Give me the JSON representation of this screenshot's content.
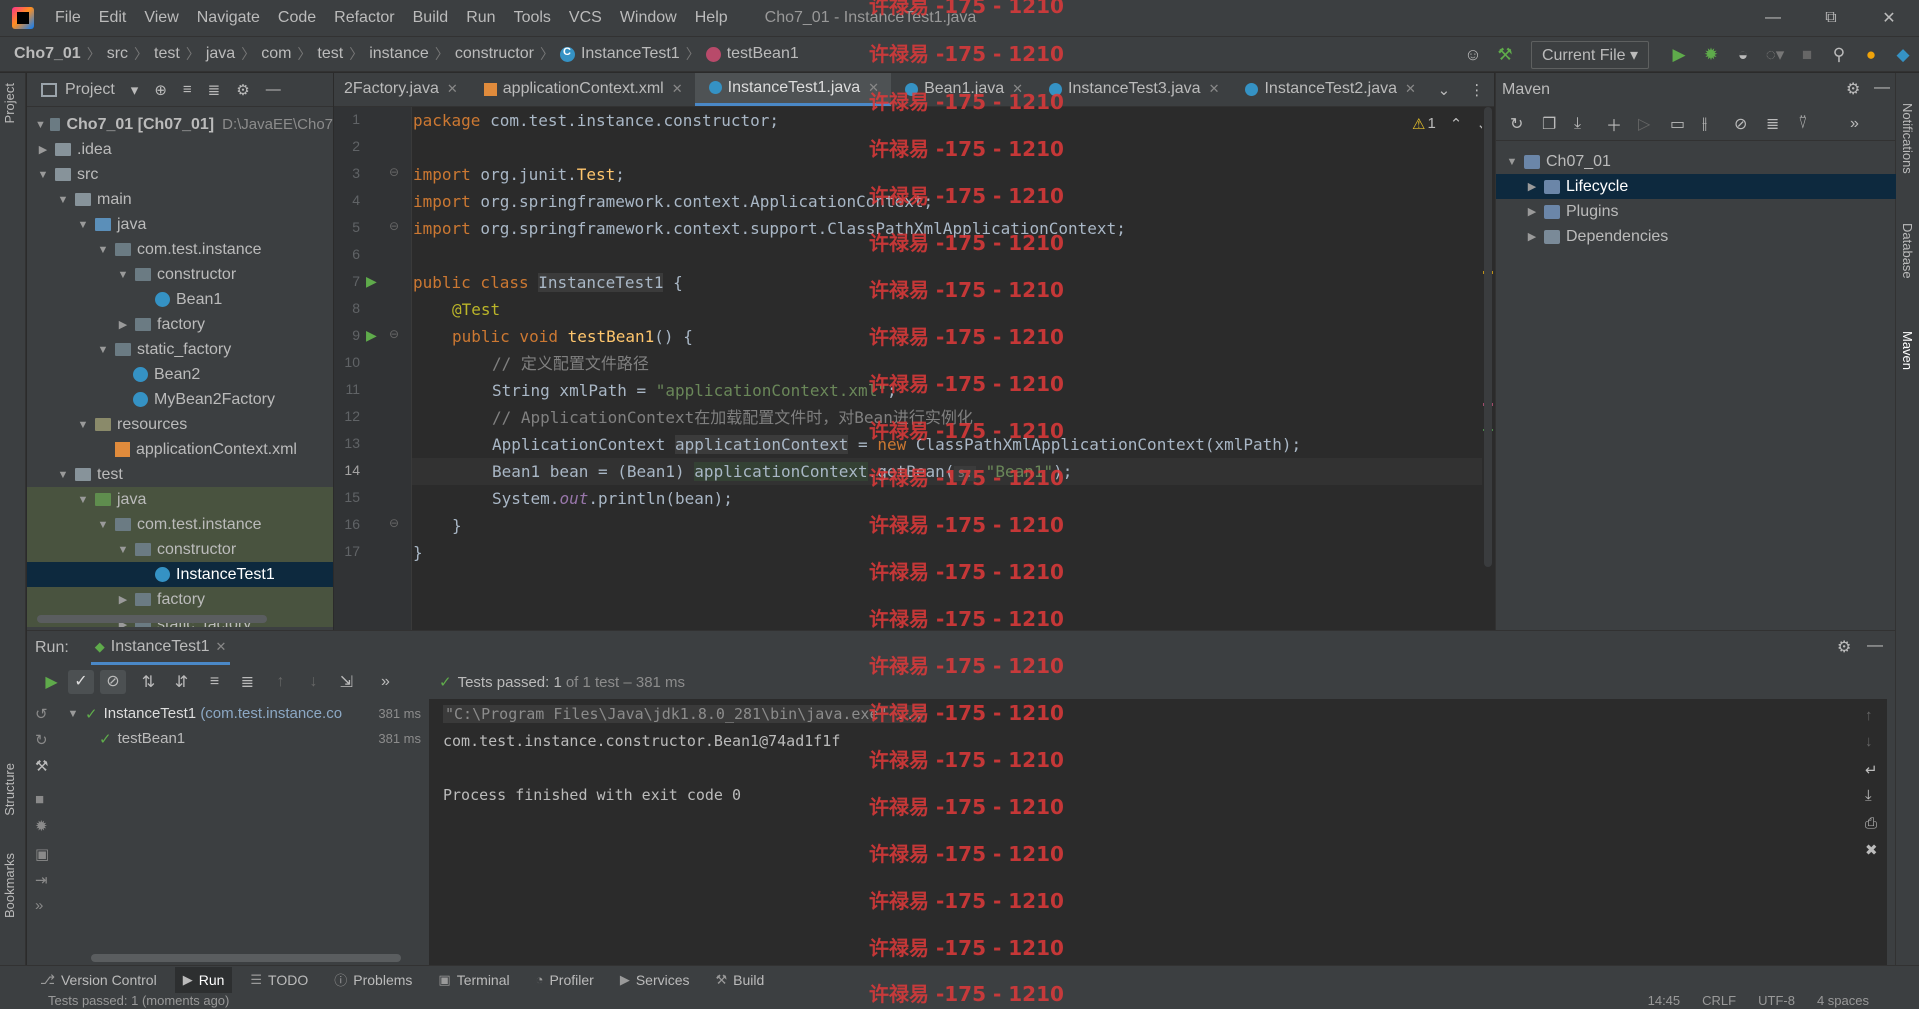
{
  "titlebar": {
    "menus": [
      "File",
      "Edit",
      "View",
      "Navigate",
      "Code",
      "Refactor",
      "Build",
      "Run",
      "Tools",
      "VCS",
      "Window",
      "Help"
    ],
    "window_title": "Cho7_01 - InstanceTest1.java"
  },
  "navbar": {
    "crumbs": [
      "Cho7_01",
      "src",
      "test",
      "java",
      "com",
      "test",
      "instance",
      "constructor",
      "InstanceTest1",
      "testBean1"
    ],
    "run_config": "Current File"
  },
  "left_stripe": {
    "project": "Project",
    "structure": "Structure",
    "bookmarks": "Bookmarks"
  },
  "right_stripe": {
    "notifications": "Notifications",
    "database": "Database",
    "maven": "Maven"
  },
  "project": {
    "title": "Project",
    "tree": [
      {
        "label": "Cho7_01",
        "extra": "[Ch07_01]",
        "hint": "D:\\JavaEE\\Cho7"
      },
      {
        "label": ".idea"
      },
      {
        "label": "src"
      },
      {
        "label": "main"
      },
      {
        "label": "java"
      },
      {
        "label": "com.test.instance"
      },
      {
        "label": "constructor"
      },
      {
        "label": "Bean1"
      },
      {
        "label": "factory"
      },
      {
        "label": "static_factory"
      },
      {
        "label": "Bean2"
      },
      {
        "label": "MyBean2Factory"
      },
      {
        "label": "resources"
      },
      {
        "label": "applicationContext.xml"
      },
      {
        "label": "test"
      },
      {
        "label": "java"
      },
      {
        "label": "com.test.instance"
      },
      {
        "label": "constructor"
      },
      {
        "label": "InstanceTest1"
      },
      {
        "label": "factory"
      },
      {
        "label": "static_factory"
      }
    ]
  },
  "editor": {
    "tabs": [
      "2Factory.java",
      "applicationContext.xml",
      "InstanceTest1.java",
      "Bean1.java",
      "InstanceTest3.java",
      "InstanceTest2.java"
    ],
    "warning_count": "1",
    "line_numbers": [
      "1",
      "2",
      "3",
      "4",
      "5",
      "6",
      "7",
      "8",
      "9",
      "10",
      "11",
      "12",
      "13",
      "14",
      "15",
      "16",
      "17"
    ],
    "code": {
      "l1_kw": "package",
      "l1_rest": " com.test.instance.constructor;",
      "l3_kw": "import",
      "l3_a": " org.junit.",
      "l3_b": "Test",
      "l3_c": ";",
      "l4_kw": "import",
      "l4_rest": " org.springframework.context.ApplicationContext;",
      "l5_kw": "import",
      "l5_rest": " org.springframework.context.support.ClassPathXmlApplicationContext;",
      "l7_kw": "public class ",
      "l7_cls": "InstanceTest1",
      "l7_rest": " {",
      "l8_ann": "@Test",
      "l9_kw": "public void ",
      "l9_fn": "testBean1",
      "l9_rest": "() {",
      "l10_cmt": "// 定义配置文件路径",
      "l11_a": "String xmlPath = ",
      "l11_str": "\"applicationContext.xml\"",
      "l11_b": ";",
      "l12_cmt": "// ApplicationContext在加载配置文件时，对Bean进行实例化",
      "l13_a": "ApplicationContext ",
      "l13_var": "applicationContext",
      "l13_b": " = ",
      "l13_kw": "new",
      "l13_c": " ClassPathXmlApplicationContext(xmlPath);",
      "l14_a": "Bean1 bean = (Bean1) ",
      "l14_var": "applicationContext",
      "l14_b": ".getBean(",
      "l14_hint": "s:",
      "l14_str": " \"Bean1\"",
      "l14_c": ");",
      "l15_a": "System.",
      "l15_st": "out",
      "l15_b": ".println(bean);",
      "l16": "}",
      "l17": "}"
    }
  },
  "maven": {
    "title": "Maven",
    "tree": [
      "Ch07_01",
      "Lifecycle",
      "Plugins",
      "Dependencies"
    ]
  },
  "run": {
    "label": "Run:",
    "tab": "InstanceTest1",
    "summary_prefix": "Tests passed:",
    "summary_count": "1",
    "summary_rest": "of 1 test – 381 ms",
    "tests": [
      {
        "name": "InstanceTest1",
        "pkg": "(com.test.instance.co",
        "time": "381 ms"
      },
      {
        "name": "testBean1",
        "time": "381 ms"
      }
    ],
    "console": [
      "\"C:\\Program Files\\Java\\jdk1.8.0_281\\bin\\java.exe\" ...",
      "com.test.instance.constructor.Bean1@74ad1f1f",
      "",
      "Process finished with exit code 0"
    ]
  },
  "bottom_bar": [
    "Version Control",
    "Run",
    "TODO",
    "Problems",
    "Terminal",
    "Profiler",
    "Services",
    "Build"
  ],
  "status": {
    "message": "Tests passed: 1 (moments ago)",
    "position": "14:45",
    "line_sep": "CRLF",
    "encoding": "UTF-8",
    "indent": "4 spaces"
  },
  "watermark": "许禄易 -175 - 1210",
  "colors": {
    "accent": "#4a88c7",
    "selected": "#0d293e",
    "test_bg": "#49533f",
    "watermark": "#e03a3a",
    "pass": "#5fab4b"
  }
}
